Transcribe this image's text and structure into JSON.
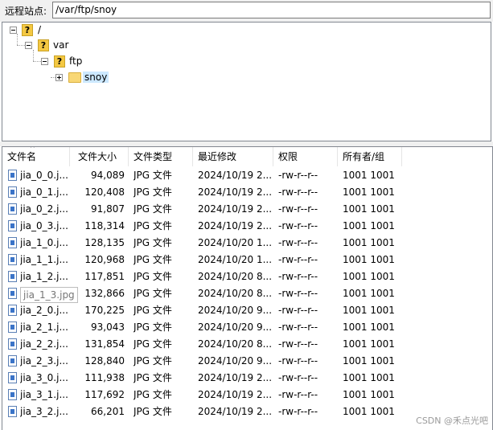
{
  "remote_site": {
    "label": "远程站点:",
    "path": "/var/ftp/snoy"
  },
  "tree": {
    "nodes": [
      {
        "label": "/"
      },
      {
        "label": "var"
      },
      {
        "label": "ftp"
      },
      {
        "label": "snoy"
      }
    ]
  },
  "columns": [
    "文件名",
    "文件大小",
    "文件类型",
    "最近修改",
    "权限",
    "所有者/组"
  ],
  "files": [
    {
      "name": "jia_0_0.j...",
      "size": "94,089",
      "type": "JPG 文件",
      "modified": "2024/10/19 2...",
      "perm": "-rw-r--r--",
      "owner": "1001 1001"
    },
    {
      "name": "jia_0_1.j...",
      "size": "120,408",
      "type": "JPG 文件",
      "modified": "2024/10/19 2...",
      "perm": "-rw-r--r--",
      "owner": "1001 1001"
    },
    {
      "name": "jia_0_2.j...",
      "size": "91,807",
      "type": "JPG 文件",
      "modified": "2024/10/19 2...",
      "perm": "-rw-r--r--",
      "owner": "1001 1001"
    },
    {
      "name": "jia_0_3.j...",
      "size": "118,314",
      "type": "JPG 文件",
      "modified": "2024/10/19 2...",
      "perm": "-rw-r--r--",
      "owner": "1001 1001"
    },
    {
      "name": "jia_1_0.j...",
      "size": "128,135",
      "type": "JPG 文件",
      "modified": "2024/10/20 1...",
      "perm": "-rw-r--r--",
      "owner": "1001 1001"
    },
    {
      "name": "jia_1_1.j...",
      "size": "120,968",
      "type": "JPG 文件",
      "modified": "2024/10/20 1...",
      "perm": "-rw-r--r--",
      "owner": "1001 1001"
    },
    {
      "name": "jia_1_2.j...",
      "size": "117,851",
      "type": "JPG 文件",
      "modified": "2024/10/20 8...",
      "perm": "-rw-r--r--",
      "owner": "1001 1001"
    },
    {
      "name": "",
      "size": "132,866",
      "type": "JPG 文件",
      "modified": "2024/10/20 8...",
      "perm": "-rw-r--r--",
      "owner": "1001 1001"
    },
    {
      "name": "jia_2_0.j...",
      "size": "170,225",
      "type": "JPG 文件",
      "modified": "2024/10/20 9...",
      "perm": "-rw-r--r--",
      "owner": "1001 1001"
    },
    {
      "name": "jia_2_1.j...",
      "size": "93,043",
      "type": "JPG 文件",
      "modified": "2024/10/20 9...",
      "perm": "-rw-r--r--",
      "owner": "1001 1001"
    },
    {
      "name": "jia_2_2.j...",
      "size": "131,854",
      "type": "JPG 文件",
      "modified": "2024/10/20 8...",
      "perm": "-rw-r--r--",
      "owner": "1001 1001"
    },
    {
      "name": "jia_2_3.j...",
      "size": "128,840",
      "type": "JPG 文件",
      "modified": "2024/10/20 9...",
      "perm": "-rw-r--r--",
      "owner": "1001 1001"
    },
    {
      "name": "jia_3_0.j...",
      "size": "111,938",
      "type": "JPG 文件",
      "modified": "2024/10/19 2...",
      "perm": "-rw-r--r--",
      "owner": "1001 1001"
    },
    {
      "name": "jia_3_1.j...",
      "size": "117,692",
      "type": "JPG 文件",
      "modified": "2024/10/19 2...",
      "perm": "-rw-r--r--",
      "owner": "1001 1001"
    },
    {
      "name": "jia_3_2.j...",
      "size": "66,201",
      "type": "JPG 文件",
      "modified": "2024/10/19 2...",
      "perm": "-rw-r--r--",
      "owner": "1001 1001"
    }
  ],
  "tooltip": "jia_1_3.jpg",
  "watermark": "CSDN @禾点光吧"
}
